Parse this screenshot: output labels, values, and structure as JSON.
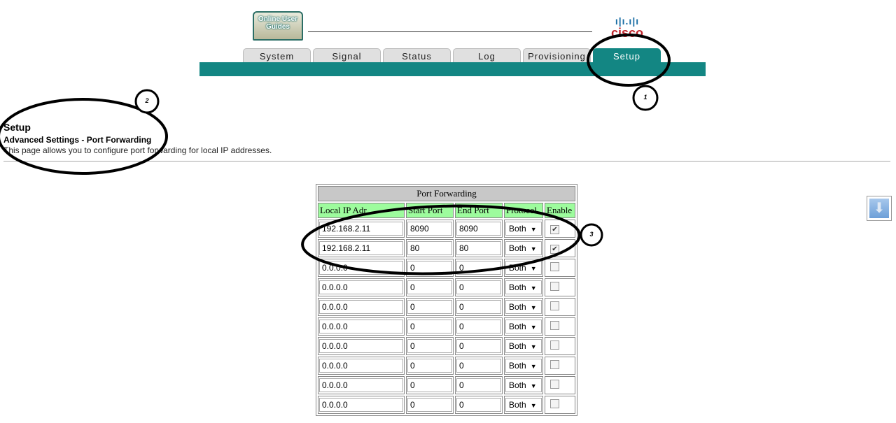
{
  "header": {
    "logo_text": "Online User Guides",
    "brand": "cisco"
  },
  "tabs": [
    {
      "label": "System"
    },
    {
      "label": "Signal"
    },
    {
      "label": "Status"
    },
    {
      "label": "Log"
    },
    {
      "label": "Provisioning"
    },
    {
      "label": "Setup",
      "active": true
    }
  ],
  "page": {
    "title": "Setup",
    "subtitle": "Advanced Settings - Port Forwarding",
    "description": "This page allows you to configure port forwarding for local IP addresses."
  },
  "table": {
    "caption": "Port Forwarding",
    "headers": [
      "Local IP Adr",
      "Start Port",
      "End Port",
      "Protocol",
      "Enable"
    ],
    "rows": [
      {
        "ip": "192.168.2.11",
        "start": "8090",
        "end": "8090",
        "protocol": "Both",
        "enabled": true
      },
      {
        "ip": "192.168.2.11",
        "start": "80",
        "end": "80",
        "protocol": "Both",
        "enabled": true
      },
      {
        "ip": "0.0.0.0",
        "start": "0",
        "end": "0",
        "protocol": "Both",
        "enabled": false
      },
      {
        "ip": "0.0.0.0",
        "start": "0",
        "end": "0",
        "protocol": "Both",
        "enabled": false
      },
      {
        "ip": "0.0.0.0",
        "start": "0",
        "end": "0",
        "protocol": "Both",
        "enabled": false
      },
      {
        "ip": "0.0.0.0",
        "start": "0",
        "end": "0",
        "protocol": "Both",
        "enabled": false
      },
      {
        "ip": "0.0.0.0",
        "start": "0",
        "end": "0",
        "protocol": "Both",
        "enabled": false
      },
      {
        "ip": "0.0.0.0",
        "start": "0",
        "end": "0",
        "protocol": "Both",
        "enabled": false
      },
      {
        "ip": "0.0.0.0",
        "start": "0",
        "end": "0",
        "protocol": "Both",
        "enabled": false
      },
      {
        "ip": "0.0.0.0",
        "start": "0",
        "end": "0",
        "protocol": "Both",
        "enabled": false
      }
    ]
  },
  "annotations": [
    "1",
    "2",
    "3"
  ],
  "colors": {
    "accent": "#138683",
    "header_green": "#9dfc9d",
    "brand_red": "#c0262d"
  }
}
